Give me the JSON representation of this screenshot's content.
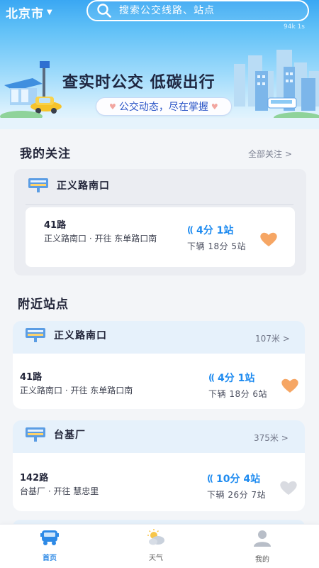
{
  "header": {
    "city": "北京市",
    "search_placeholder": "搜索公交线路、站点",
    "status_text": "94k 1s"
  },
  "banner": {
    "headline": "查实时公交  低碳出行",
    "tagline": "公交动态，尽在掌握"
  },
  "favorites": {
    "title": "我的关注",
    "all_link": "全部关注 >",
    "stop_name": "正义路南口",
    "route": {
      "number": "41路",
      "direction": "正义路南口 · 开往 东单路口南",
      "eta": "4分  1站",
      "detail": "下辆 18分 5站",
      "favorited": true
    }
  },
  "nearby": {
    "title": "附近站点",
    "stops": [
      {
        "name": "正义路南口",
        "distance": "107米 >",
        "route": {
          "number": "41路",
          "direction": "正义路南口 · 开往 东单路口南",
          "eta": "4分  1站",
          "detail": "下辆 18分 6站",
          "favorited": true
        }
      },
      {
        "name": "台基厂",
        "distance": "375米 >",
        "route": {
          "number": "142路",
          "direction": "台基厂 · 开往 慧忠里",
          "eta": "10分  4站",
          "detail": "下辆 26分 7站",
          "favorited": false
        }
      }
    ]
  },
  "bottom_nav": [
    {
      "label": "首页",
      "icon": "bus-icon",
      "active": true
    },
    {
      "label": "天气",
      "icon": "weather-icon",
      "active": false
    },
    {
      "label": "我的",
      "icon": "profile-icon",
      "active": false
    }
  ],
  "colors": {
    "accent": "#1e8bf0",
    "heart_active": "#f6a664",
    "heart_inactive": "#d9dbe1"
  }
}
